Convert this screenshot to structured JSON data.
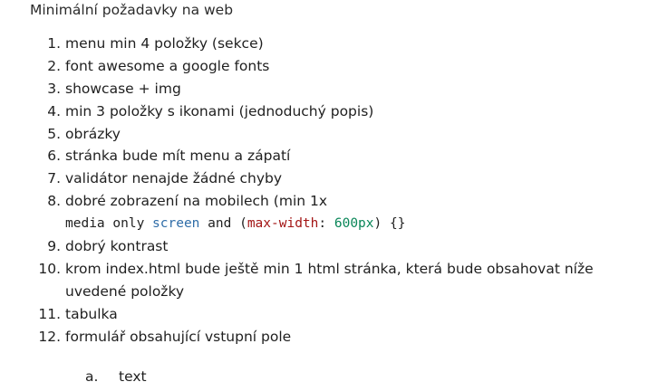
{
  "heading": "Minimální požadavky na web",
  "items": [
    {
      "num": "1.",
      "text": "menu min 4 položky (sekce)"
    },
    {
      "num": "2.",
      "text": "font awesome a google fonts"
    },
    {
      "num": "3.",
      "text": "showcase + img"
    },
    {
      "num": "4.",
      "text": "min 3 položky s ikonami (jednoduchý popis)"
    },
    {
      "num": "5.",
      "text": "obrázky"
    },
    {
      "num": "6.",
      "text": "stránka bude mít menu a zápatí"
    },
    {
      "num": "7.",
      "text": "validátor nenajde žádné chyby"
    },
    {
      "num": "8.",
      "text": "dobré zobrazení na mobilech (min 1x",
      "code": {
        "t1": "media only ",
        "t2": "screen",
        "t3": " and ",
        "t4": "(",
        "t5": "max-width",
        "t6": ": ",
        "t7": "600px",
        "t8": ") {}"
      }
    },
    {
      "num": "9.",
      "text": "dobrý kontrast"
    },
    {
      "num": "10.",
      "text": "krom index.html bude ještě min 1 html stránka, která bude obsahovat níže",
      "cont": "uvedené položky"
    },
    {
      "num": "11.",
      "text": "tabulka"
    },
    {
      "num": "12.",
      "text": "formulář obsahující vstupní pole"
    }
  ],
  "subitem": {
    "letter": "a.",
    "text": "text"
  },
  "colors": {
    "keyword_blue": "#2f6da8",
    "property_red": "#a31515",
    "number_green": "#098658"
  }
}
